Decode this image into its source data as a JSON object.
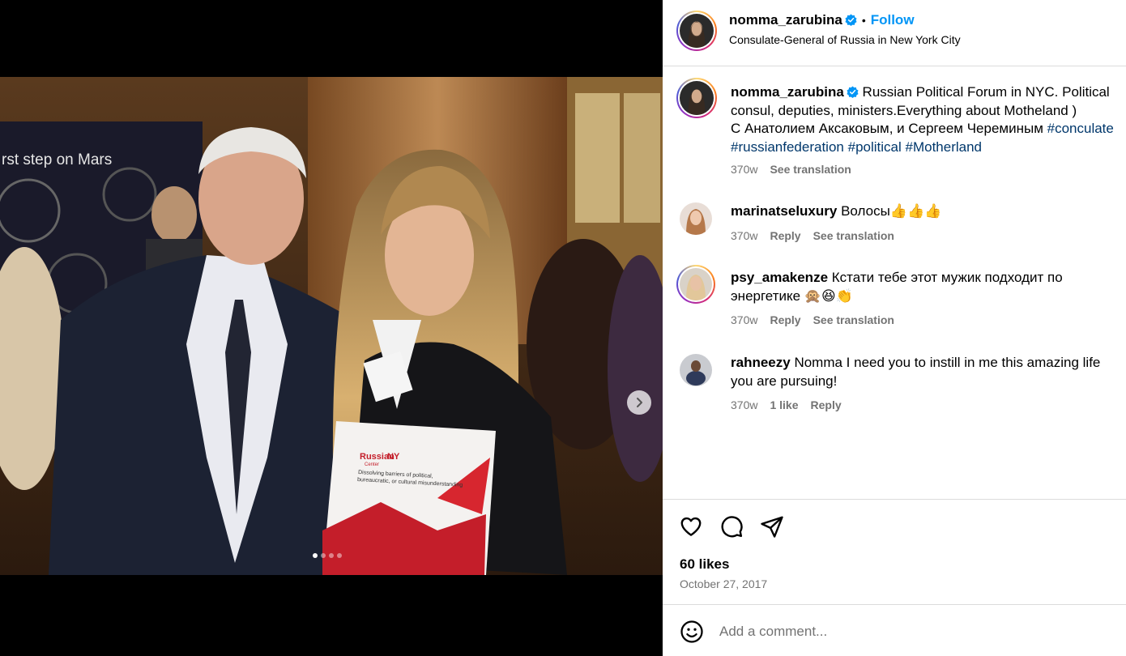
{
  "post": {
    "author": "nomma_zarubina",
    "follow_label": "Follow",
    "separator": "•",
    "location": "Consulate-General of Russia in New York City"
  },
  "caption": {
    "username": "nomma_zarubina",
    "text_line1": "Russian Political Forum in NYC. Political consul, deputies, ministers.Everything about Motheland )",
    "text_line2": "С Анатолием Аксаковым, и Сергеем Череминым",
    "tags": [
      "#conculate",
      "#russianfederation",
      "#political",
      "#Motherland"
    ],
    "time": "370w",
    "see_translation": "See translation"
  },
  "comments": [
    {
      "username": "marinatseluxury",
      "text": "Волосы👍👍👍",
      "time": "370w",
      "reply": "Reply",
      "see_translation": "See translation"
    },
    {
      "username": "psy_amakenze",
      "text": "Кстати тебе этот мужик подходит по энергетике 🙊😆👏",
      "time": "370w",
      "reply": "Reply",
      "see_translation": "See translation"
    },
    {
      "username": "rahneezy",
      "text": "Nomma I need you to instill in me this amazing life you are pursuing!",
      "time": "370w",
      "likes": "1 like",
      "reply": "Reply"
    }
  ],
  "stats": {
    "likes": "60 likes",
    "date": "October 27, 2017"
  },
  "composer": {
    "placeholder": "Add a comment..."
  },
  "carousel": {
    "count": 4,
    "active": 0
  },
  "photo_text": {
    "banner": "rst step on Mars",
    "brochure_brand": "Russian",
    "brochure_brand2": "NY",
    "brochure_brand_small": "Center",
    "brochure_tagline1": "Dissolving barriers of political,",
    "brochure_tagline2": "bureaucratic, or cultural misunderstanding"
  },
  "icons": [
    "verified-badge-icon",
    "heart-icon",
    "comment-icon",
    "share-icon",
    "emoji-icon",
    "chevron-right-icon"
  ],
  "colors": {
    "link": "#0095f6",
    "hashtag": "#00376b",
    "muted": "#737373",
    "border": "#dbdbdb"
  }
}
